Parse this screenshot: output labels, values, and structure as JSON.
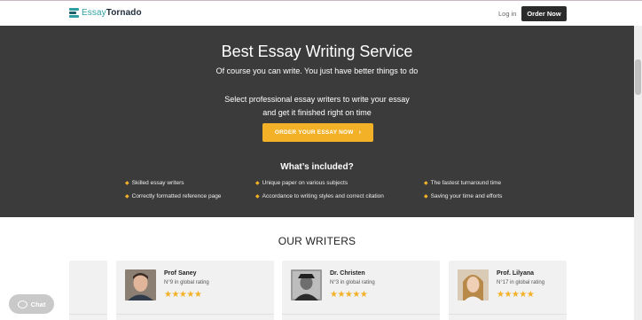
{
  "header": {
    "logo_part1": "Essay",
    "logo_part2": "Tornado",
    "login": "Log in",
    "order": "Order Now"
  },
  "hero": {
    "title": "Best Essay Writing Service",
    "subtitle": "Of course you can write. You just have better things to do",
    "desc_line1": "Select professional essay writers to write your essay",
    "desc_line2": "and get it finished right on time",
    "cta": "ORDER YOUR ESSAY NOW",
    "included_title": "What’s included?",
    "features": [
      "Skilled essay writers",
      "Unique paper on various subjects",
      "The fastest turnaround time",
      "Correctly formatted reference page",
      "Accordance to writing styles and correct citation",
      "Saving your time and efforts"
    ]
  },
  "writers": {
    "title": "OUR WRITERS",
    "cards": [
      {
        "name": "Prof Saney",
        "rank": "N°9 in global rating",
        "stars": "★★★★★"
      },
      {
        "name": "Dr. Christen",
        "rank": "N°3 in global rating",
        "stars": "★★★★★"
      },
      {
        "name": "Prof. Lilyana",
        "rank": "N°17 in global rating",
        "stars": "★★★★★"
      }
    ]
  },
  "chat": {
    "label": "Chat"
  },
  "colors": {
    "accent": "#f2b127",
    "hero_bg": "#3b3b3b",
    "brand": "#2e9fa0"
  }
}
